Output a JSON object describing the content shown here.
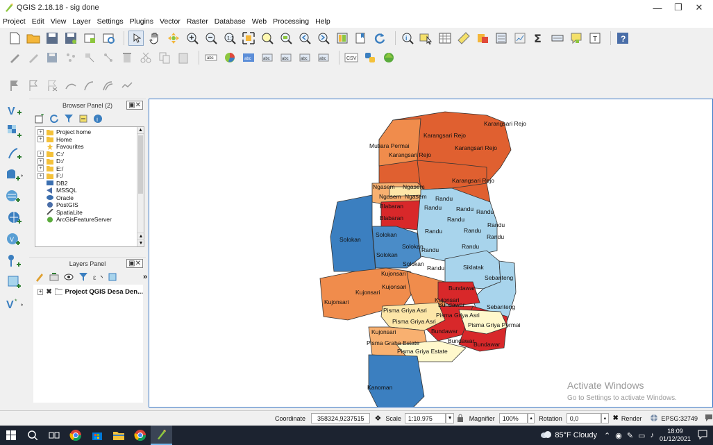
{
  "window": {
    "title": "QGIS 2.18.18 - sig done"
  },
  "menu": [
    "Project",
    "Edit",
    "View",
    "Layer",
    "Settings",
    "Plugins",
    "Vector",
    "Raster",
    "Database",
    "Web",
    "Processing",
    "Help"
  ],
  "toolbar1": {
    "icons": [
      "new-project-icon",
      "open-project-icon",
      "save-project-icon",
      "save-as-icon",
      "new-print-composer-icon",
      "composer-manager-icon",
      "touch-zoom-icon",
      "pan-icon",
      "pan-to-selection-icon",
      "zoom-in-icon",
      "zoom-out-icon",
      "zoom-native-icon",
      "zoom-full-icon",
      "zoom-to-selection-icon",
      "zoom-to-layer-icon",
      "zoom-last-icon",
      "zoom-next-icon",
      "new-map-view-icon",
      "new-bookmark-icon",
      "refresh-icon",
      "identify-icon",
      "select-features-icon",
      "open-attribute-table-icon",
      "measure-icon",
      "style-icon",
      "field-calculator-icon",
      "statistics-icon",
      "sum-icon",
      "annotation-icon",
      "tips-icon",
      "text-annotation-icon",
      "help-icon"
    ]
  },
  "toolbar2": {
    "icons": [
      "current-edits-icon",
      "toggle-editing-icon",
      "save-edits-icon",
      "add-feature-icon",
      "move-feature-icon",
      "node-tool-icon",
      "delete-selected-icon",
      "cut-features-icon",
      "copy-features-icon",
      "paste-features-icon",
      "label-icon",
      "layer-diagram-icon",
      "pin-labels-icon",
      "show-hide-labels-icon",
      "move-label-icon",
      "rotate-label-icon",
      "change-label-icon",
      "csv-icon",
      "python-icon",
      "plugin-icon"
    ]
  },
  "toolbar3": {
    "icons": [
      "flag-icon",
      "digitize-icon",
      "stop-digitize-icon",
      "split-icon",
      "reshape-icon",
      "offset-curve-icon",
      "simplify-icon"
    ]
  },
  "left_tools": [
    "add-vector-layer-icon",
    "add-raster-layer-icon",
    "add-delimited-text-icon",
    "add-spatialite-icon",
    "add-wms-icon",
    "add-wcs-icon",
    "add-wfs-icon",
    "add-postgis-icon",
    "add-mssql-icon",
    "new-shapefile-icon"
  ],
  "browser_panel": {
    "title": "Browser Panel (2)",
    "items": [
      {
        "label": "Project home",
        "expandable": true
      },
      {
        "label": "Home",
        "expandable": true
      },
      {
        "label": "Favourites",
        "expandable": false
      },
      {
        "label": "C:/",
        "expandable": true
      },
      {
        "label": "D:/",
        "expandable": true
      },
      {
        "label": "E:/",
        "expandable": true
      },
      {
        "label": "F:/",
        "expandable": true
      },
      {
        "label": "DB2",
        "expandable": false
      },
      {
        "label": "MSSQL",
        "expandable": false
      },
      {
        "label": "Oracle",
        "expandable": false
      },
      {
        "label": "PostGIS",
        "expandable": false
      },
      {
        "label": "SpatiaLite",
        "expandable": false
      },
      {
        "label": "ArcGisFeatureServer",
        "expandable": false
      }
    ]
  },
  "layers_panel": {
    "title": "Layers Panel",
    "items": [
      {
        "label": "Project QGIS Desa Den...",
        "checked": false
      }
    ]
  },
  "map": {
    "labels": [
      {
        "text": "Karangsari Rejo"
      },
      {
        "text": "Karangsari Rejo"
      },
      {
        "text": "Mutiara Permai"
      },
      {
        "text": "Karangsari Rejo"
      },
      {
        "text": "Karangsari Rejo"
      },
      {
        "text": "Karangsari Rejo"
      },
      {
        "text": "Ngasem"
      },
      {
        "text": "Ngasem"
      },
      {
        "text": "Ngasem"
      },
      {
        "text": "Ngasem"
      },
      {
        "text": "Randu"
      },
      {
        "text": "Blabaran"
      },
      {
        "text": "Randu"
      },
      {
        "text": "Randu"
      },
      {
        "text": "Randu"
      },
      {
        "text": "Blabaran"
      },
      {
        "text": "Randu"
      },
      {
        "text": "Randu"
      },
      {
        "text": "Randu"
      },
      {
        "text": "Randu"
      },
      {
        "text": "Solokan"
      },
      {
        "text": "Solokan"
      },
      {
        "text": "Randu"
      },
      {
        "text": "Randu"
      },
      {
        "text": "Solokan"
      },
      {
        "text": "Randu"
      },
      {
        "text": "Solokan"
      },
      {
        "text": "Solokan"
      },
      {
        "text": "Randu"
      },
      {
        "text": "Siklatak"
      },
      {
        "text": "Kujonsari"
      },
      {
        "text": "Sebanteng"
      },
      {
        "text": "Kujonsari"
      },
      {
        "text": "Bundawar"
      },
      {
        "text": "Kujonsari"
      },
      {
        "text": "Kujonsari"
      },
      {
        "text": "Kujonsari"
      },
      {
        "text": "Bundawar"
      },
      {
        "text": "Sebanteng"
      },
      {
        "text": "Pisma Griya Asri"
      },
      {
        "text": "Pisma Griya Asri"
      },
      {
        "text": "Pisma Griya Asri"
      },
      {
        "text": "Pisma Griya Permai"
      },
      {
        "text": "Kujonsari"
      },
      {
        "text": "Bundawar"
      },
      {
        "text": "Bundawar"
      },
      {
        "text": "Bundawar"
      },
      {
        "text": "Pisma Graha Estate"
      },
      {
        "text": "Pisma Griya Estate"
      },
      {
        "text": "Kanoman"
      }
    ],
    "colors": {
      "dark_orange": "#e06030",
      "orange": "#f08c4c",
      "light_orange": "#f8b070",
      "pale": "#fde6a8",
      "cream": "#fff8cc",
      "light_blue": "#a8d4ec",
      "mid_blue": "#5a9fd4",
      "blue": "#3b7fc0",
      "red": "#d8282a",
      "steel": "#4a8cc8"
    }
  },
  "watermark": {
    "line1": "Activate Windows",
    "line2": "Go to Settings to activate Windows."
  },
  "status": {
    "coordinate_label": "Coordinate",
    "coordinate_value": "358324,9237515",
    "scale_label": "Scale",
    "scale_value": "1:10.975",
    "magnifier_label": "Magnifier",
    "magnifier_value": "100%",
    "rotation_label": "Rotation",
    "rotation_value": "0,0",
    "render_label": "Render",
    "crs": "EPSG:32749"
  },
  "taskbar": {
    "weather": "85°F  Cloudy",
    "time": "18:09",
    "date": "01/12/2021"
  }
}
